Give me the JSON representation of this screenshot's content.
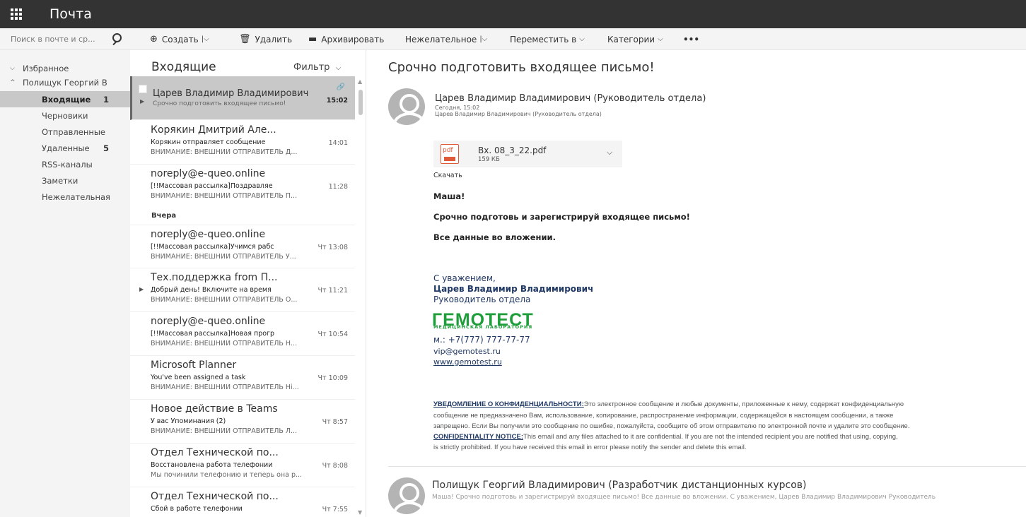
{
  "app": {
    "title": "Почта"
  },
  "search": {
    "placeholder": "Поиск в почте и ср..."
  },
  "toolbar": {
    "create": "Создать",
    "delete": "Удалить",
    "archive": "Архивировать",
    "junk": "Нежелательное",
    "move": "Переместить в",
    "categories": "Категории",
    "more": "•••"
  },
  "folders": {
    "favorites": "Избранное",
    "account": "Полищук Георгий В",
    "items": [
      {
        "label": "Входящие",
        "count": "1"
      },
      {
        "label": "Черновики",
        "count": ""
      },
      {
        "label": "Отправленные",
        "count": ""
      },
      {
        "label": "Удаленные",
        "count": "5"
      },
      {
        "label": "RSS-каналы",
        "count": ""
      },
      {
        "label": "Заметки",
        "count": ""
      },
      {
        "label": "Нежелательная",
        "count": ""
      }
    ]
  },
  "list": {
    "title": "Входящие",
    "filter": "Фильтр",
    "day_separator": "Вчера",
    "messages": [
      {
        "from": "Царев Владимир Владимирович",
        "subject": "Срочно подготовить входящее письмо!",
        "preview": "",
        "time": "15:02"
      },
      {
        "from": "Корякин Дмитрий Але...",
        "subject": "Корякин отправляет сообщение",
        "preview": "ВНИМАНИЕ: ВНЕШНИЙ ОТПРАВИТЕЛЬ Д...",
        "time": "14:01"
      },
      {
        "from": "noreply@e-queo.online",
        "subject": "[!!Массовая рассылка]Поздравляе",
        "preview": "ВНИМАНИЕ: ВНЕШНИЙ ОТПРАВИТЕЛЬ П...",
        "time": "11:28"
      },
      {
        "from": "noreply@e-queo.online",
        "subject": "[!!Массовая рассылка]Учимся рабс",
        "preview": "ВНИМАНИЕ: ВНЕШНИЙ ОТПРАВИТЕЛЬ У...",
        "time": "Чт 13:08"
      },
      {
        "from": "Тех.поддержка from П...",
        "subject": "Добрый день! Включите на время",
        "preview": "ВНИМАНИЕ: ВНЕШНИЙ ОТПРАВИТЕЛЬ О...",
        "time": "Чт 11:21"
      },
      {
        "from": "noreply@e-queo.online",
        "subject": "[!!Массовая рассылка]Новая прогр",
        "preview": "ВНИМАНИЕ: ВНЕШНИЙ ОТПРАВИТЕЛЬ Н...",
        "time": "Чт 10:54"
      },
      {
        "from": "Microsoft Planner",
        "subject": "You've been assigned a task",
        "preview": "ВНИМАНИЕ: ВНЕШНИЙ ОТПРАВИТЕЛЬ Hi...",
        "time": "Чт 10:09"
      },
      {
        "from": "Новое действие в Teams",
        "subject": "У вас Упоминания (2)",
        "preview": "ВНИМАНИЕ: ВНЕШНИЙ ОТПРАВИТЕЛЬ Л...",
        "time": "Чт 8:57"
      },
      {
        "from": "Отдел Технической по...",
        "subject": "Восстановлена работа телефонии",
        "preview": "Мы починили телефонию и теперь она р...",
        "time": "Чт 8:08"
      },
      {
        "from": "Отдел Технической по...",
        "subject": "Сбой в работе телефонии",
        "preview": "",
        "time": "Чт 7:55"
      }
    ]
  },
  "reading": {
    "subject": "Срочно подготовить входящее письмо!",
    "sender": "Царев Владимир Владимирович (Руководитель отдела)",
    "date": "Сегодня, 15:02",
    "to": "Царев Владимир Владимирович (Руководитель отдела)",
    "attachment": {
      "name": "Вх. 08_3_22.pdf",
      "size": "159 КБ",
      "type": "pdf"
    },
    "download": "Скачать",
    "body": [
      "Маша!",
      "Срочно подготовь и зарегистрируй входящее письмо!",
      "Все данные во вложении."
    ],
    "signature": {
      "regards": "С уважением,",
      "name": "Царев Владимир Владимирович",
      "position": "Руководитель отдела",
      "logo": "ГЕМОТЕСТ",
      "logo_sub": "МЕДИЦИНСКАЯ ЛАБОРАТОРИЯ",
      "phone": "м.: +7(777) 777-77-77",
      "email": "vip@gemotest.ru",
      "website": "www.gemotest.ru"
    },
    "disclaimer": {
      "ru_title": "УВЕДОМЛЕНИЕ О КОНФИДЕНЦИАЛЬНОСТИ:",
      "ru_line1": "Это электронное сообщение и любые документы, приложенные к нему, содержат конфиденциальную",
      "ru_line2": "сообщение не предназначено Вам, использование, копирование, распространение информации, содержащейся в настоящем сообщении, а также",
      "ru_line3": "запрещено. Если Вы получили это сообщение по ошибке, пожалуйста, сообщите об этом отправителю по электронной почте и удалите это сообщение.",
      "en_title": "CONFIDENTIALITY NOTICE:",
      "en_line1": "This email and any files attached to it are confidential. If you are not the intended recipient you are notified that using, copying,",
      "en_line2": "is strictly prohibited. If you have received this email in error please notify the sender and delete this email."
    },
    "reply": {
      "sender": "Полищук Георгий Владимирович (Разработчик дистанционных курсов)",
      "preview": "Маша! Срочно подготовь и зарегистрируй входящее письмо! Все данные во вложении. С уважением, Царев Владимир Владимирович Руководитель"
    }
  },
  "colors": {
    "topbar": "#333333",
    "selected": "#c8c8c8",
    "brand_green": "#1e9e3a",
    "signature_blue": "#1f3864"
  }
}
